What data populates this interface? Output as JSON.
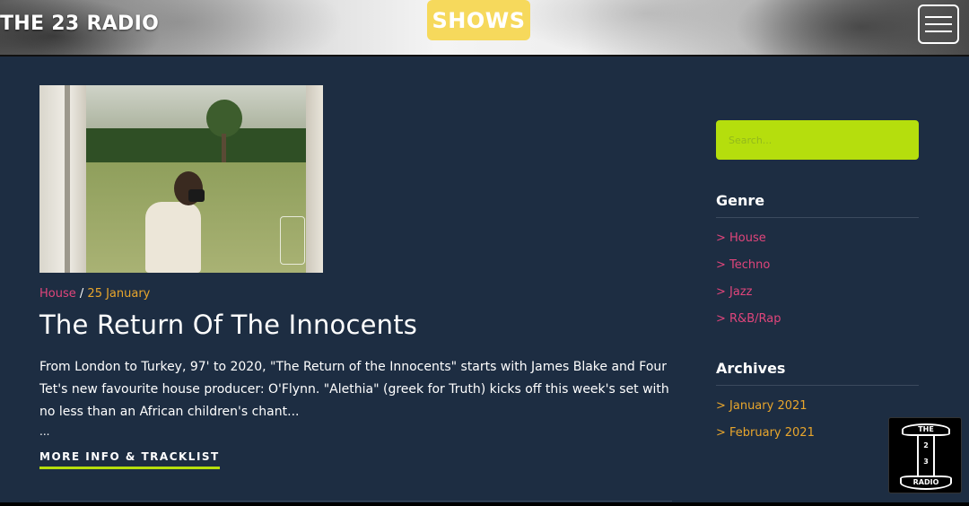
{
  "header": {
    "brand": "THE 23 RADIO",
    "shows_label": "SHOWS",
    "menu_icon": "hamburger-menu-icon"
  },
  "post": {
    "category": "House",
    "separator": "/",
    "date": "25 January",
    "title": "The Return Of The Innocents",
    "excerpt": "From London to Turkey, 97' to 2020, \"The Return of the Innocents\" starts with James Blake and Four Tet's new favourite house producer: O'Flynn. \"Alethia\" (greek for Truth) kicks off this week's set with no less than an African children's chant...",
    "ellipsis": "...",
    "more_label": "MORE INFO & TRACKLIST"
  },
  "sidebar": {
    "search_placeholder": "Search...",
    "genre_title": "Genre",
    "genres": [
      "> House",
      "> Techno",
      "> Jazz",
      "> R&B/Rap"
    ],
    "archives_title": "Archives",
    "archives": [
      "> January 2021",
      "> February 2021"
    ]
  },
  "corner_logo": {
    "line1": "THE",
    "line2": "2",
    "line3": "3",
    "line4": "RADIO"
  },
  "colors": {
    "background": "#1d2d42",
    "accent_green": "#b5de0d",
    "shows_yellow": "#f6d95c",
    "category_pink": "#e0457b",
    "date_orange": "#e9a62c"
  }
}
